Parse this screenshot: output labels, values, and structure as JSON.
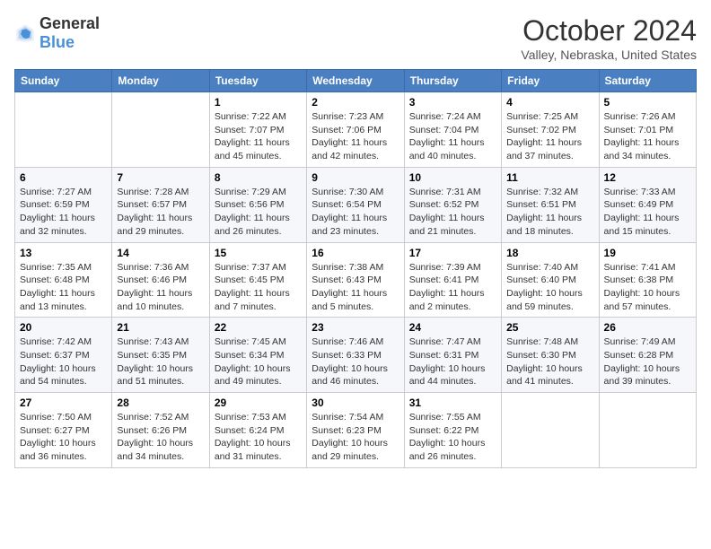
{
  "header": {
    "logo_general": "General",
    "logo_blue": "Blue",
    "month_title": "October 2024",
    "location": "Valley, Nebraska, United States"
  },
  "weekdays": [
    "Sunday",
    "Monday",
    "Tuesday",
    "Wednesday",
    "Thursday",
    "Friday",
    "Saturday"
  ],
  "weeks": [
    [
      {
        "day": "",
        "info": ""
      },
      {
        "day": "",
        "info": ""
      },
      {
        "day": "1",
        "info": "Sunrise: 7:22 AM\nSunset: 7:07 PM\nDaylight: 11 hours and 45 minutes."
      },
      {
        "day": "2",
        "info": "Sunrise: 7:23 AM\nSunset: 7:06 PM\nDaylight: 11 hours and 42 minutes."
      },
      {
        "day": "3",
        "info": "Sunrise: 7:24 AM\nSunset: 7:04 PM\nDaylight: 11 hours and 40 minutes."
      },
      {
        "day": "4",
        "info": "Sunrise: 7:25 AM\nSunset: 7:02 PM\nDaylight: 11 hours and 37 minutes."
      },
      {
        "day": "5",
        "info": "Sunrise: 7:26 AM\nSunset: 7:01 PM\nDaylight: 11 hours and 34 minutes."
      }
    ],
    [
      {
        "day": "6",
        "info": "Sunrise: 7:27 AM\nSunset: 6:59 PM\nDaylight: 11 hours and 32 minutes."
      },
      {
        "day": "7",
        "info": "Sunrise: 7:28 AM\nSunset: 6:57 PM\nDaylight: 11 hours and 29 minutes."
      },
      {
        "day": "8",
        "info": "Sunrise: 7:29 AM\nSunset: 6:56 PM\nDaylight: 11 hours and 26 minutes."
      },
      {
        "day": "9",
        "info": "Sunrise: 7:30 AM\nSunset: 6:54 PM\nDaylight: 11 hours and 23 minutes."
      },
      {
        "day": "10",
        "info": "Sunrise: 7:31 AM\nSunset: 6:52 PM\nDaylight: 11 hours and 21 minutes."
      },
      {
        "day": "11",
        "info": "Sunrise: 7:32 AM\nSunset: 6:51 PM\nDaylight: 11 hours and 18 minutes."
      },
      {
        "day": "12",
        "info": "Sunrise: 7:33 AM\nSunset: 6:49 PM\nDaylight: 11 hours and 15 minutes."
      }
    ],
    [
      {
        "day": "13",
        "info": "Sunrise: 7:35 AM\nSunset: 6:48 PM\nDaylight: 11 hours and 13 minutes."
      },
      {
        "day": "14",
        "info": "Sunrise: 7:36 AM\nSunset: 6:46 PM\nDaylight: 11 hours and 10 minutes."
      },
      {
        "day": "15",
        "info": "Sunrise: 7:37 AM\nSunset: 6:45 PM\nDaylight: 11 hours and 7 minutes."
      },
      {
        "day": "16",
        "info": "Sunrise: 7:38 AM\nSunset: 6:43 PM\nDaylight: 11 hours and 5 minutes."
      },
      {
        "day": "17",
        "info": "Sunrise: 7:39 AM\nSunset: 6:41 PM\nDaylight: 11 hours and 2 minutes."
      },
      {
        "day": "18",
        "info": "Sunrise: 7:40 AM\nSunset: 6:40 PM\nDaylight: 10 hours and 59 minutes."
      },
      {
        "day": "19",
        "info": "Sunrise: 7:41 AM\nSunset: 6:38 PM\nDaylight: 10 hours and 57 minutes."
      }
    ],
    [
      {
        "day": "20",
        "info": "Sunrise: 7:42 AM\nSunset: 6:37 PM\nDaylight: 10 hours and 54 minutes."
      },
      {
        "day": "21",
        "info": "Sunrise: 7:43 AM\nSunset: 6:35 PM\nDaylight: 10 hours and 51 minutes."
      },
      {
        "day": "22",
        "info": "Sunrise: 7:45 AM\nSunset: 6:34 PM\nDaylight: 10 hours and 49 minutes."
      },
      {
        "day": "23",
        "info": "Sunrise: 7:46 AM\nSunset: 6:33 PM\nDaylight: 10 hours and 46 minutes."
      },
      {
        "day": "24",
        "info": "Sunrise: 7:47 AM\nSunset: 6:31 PM\nDaylight: 10 hours and 44 minutes."
      },
      {
        "day": "25",
        "info": "Sunrise: 7:48 AM\nSunset: 6:30 PM\nDaylight: 10 hours and 41 minutes."
      },
      {
        "day": "26",
        "info": "Sunrise: 7:49 AM\nSunset: 6:28 PM\nDaylight: 10 hours and 39 minutes."
      }
    ],
    [
      {
        "day": "27",
        "info": "Sunrise: 7:50 AM\nSunset: 6:27 PM\nDaylight: 10 hours and 36 minutes."
      },
      {
        "day": "28",
        "info": "Sunrise: 7:52 AM\nSunset: 6:26 PM\nDaylight: 10 hours and 34 minutes."
      },
      {
        "day": "29",
        "info": "Sunrise: 7:53 AM\nSunset: 6:24 PM\nDaylight: 10 hours and 31 minutes."
      },
      {
        "day": "30",
        "info": "Sunrise: 7:54 AM\nSunset: 6:23 PM\nDaylight: 10 hours and 29 minutes."
      },
      {
        "day": "31",
        "info": "Sunrise: 7:55 AM\nSunset: 6:22 PM\nDaylight: 10 hours and 26 minutes."
      },
      {
        "day": "",
        "info": ""
      },
      {
        "day": "",
        "info": ""
      }
    ]
  ]
}
